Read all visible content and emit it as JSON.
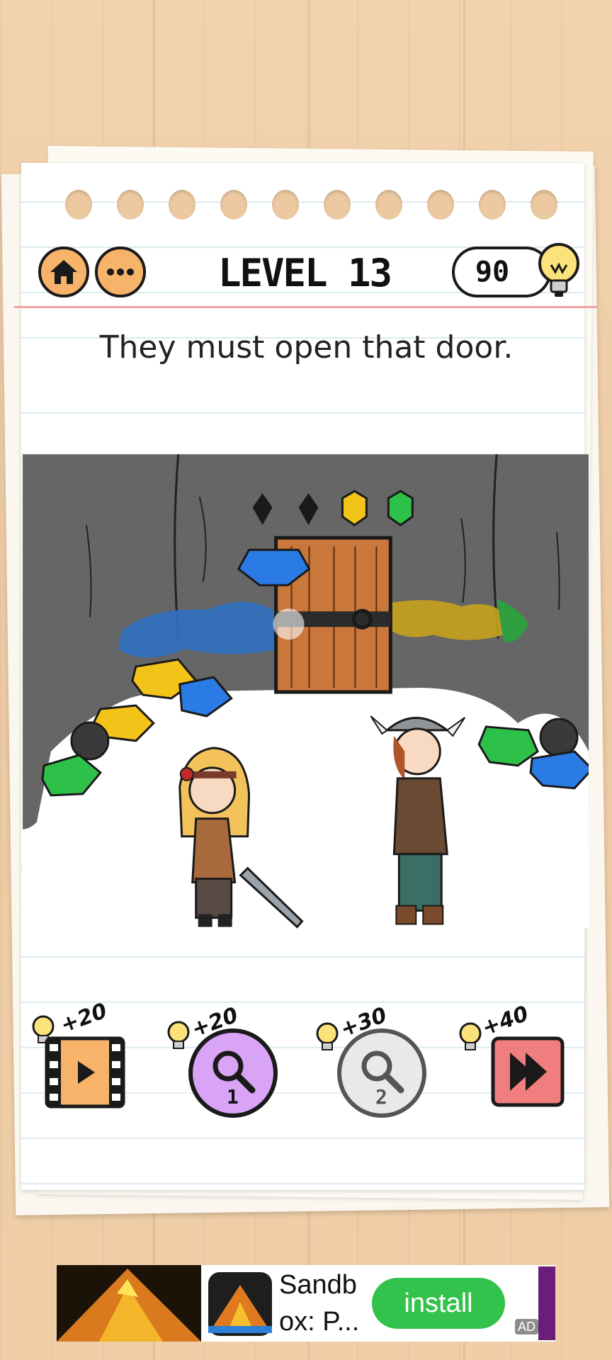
{
  "header": {
    "level_label": "LEVEL 13",
    "hint_count": "90"
  },
  "question": "They must open that door.",
  "tools": [
    {
      "name": "Watch video",
      "cost": "+20",
      "number": ""
    },
    {
      "name": "Hint 1",
      "cost": "+20",
      "number": "1"
    },
    {
      "name": "Hint 2",
      "cost": "+30",
      "number": "2"
    },
    {
      "name": "Skip level",
      "cost": "+40",
      "number": ""
    }
  ],
  "ad": {
    "title": "Sandb\nox: P...",
    "install_label": "install",
    "badge": "AD"
  },
  "colors": {
    "accent_orange": "#f6b369",
    "hint_purple": "#d9a4f5",
    "skip_red": "#f07e7e",
    "install_green": "#33c24b",
    "cave_gray": "#666666"
  },
  "icons": [
    "home-icon",
    "more-icon",
    "lightbulb-icon",
    "video-icon",
    "magnifier-icon",
    "skip-icon"
  ]
}
